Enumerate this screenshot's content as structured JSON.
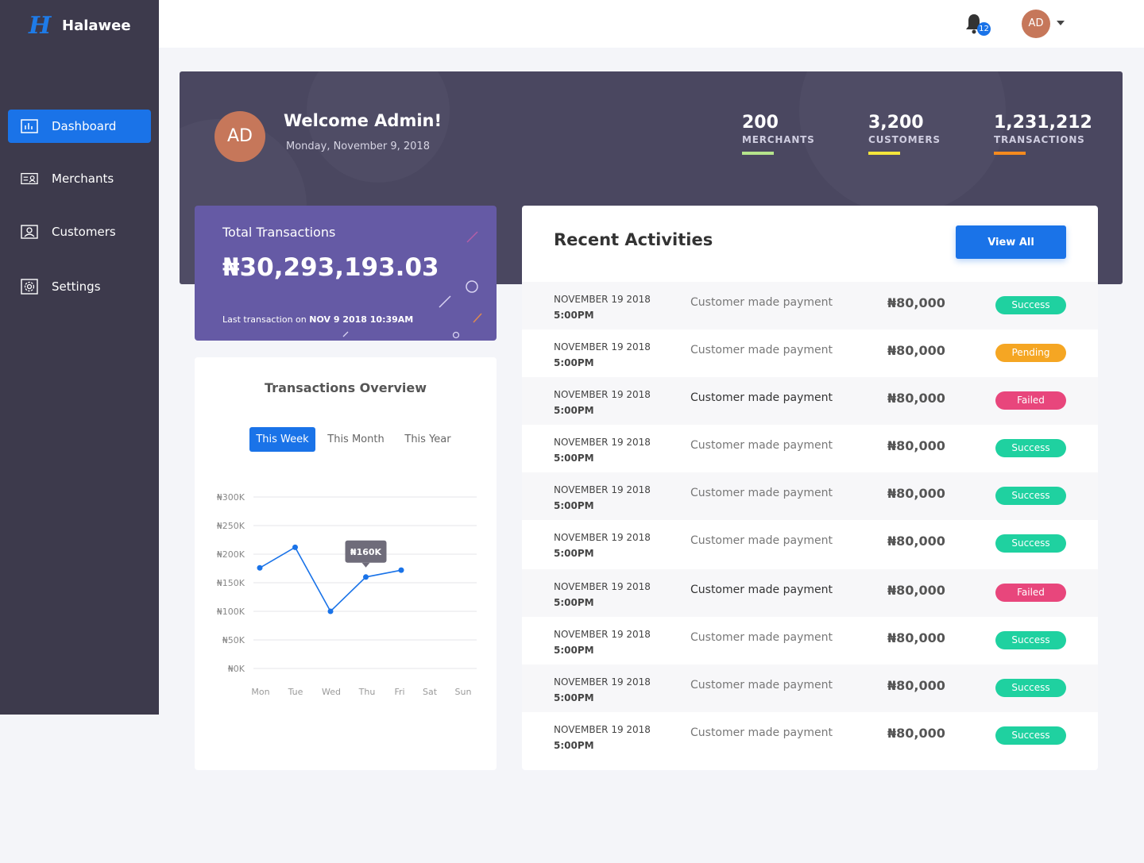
{
  "app": {
    "logo": "H",
    "name": "Halawee"
  },
  "sidebar": {
    "items": [
      {
        "label": "Dashboard",
        "icon": "bar-chart-icon",
        "active": true
      },
      {
        "label": "Merchants",
        "icon": "id-card-icon",
        "active": false
      },
      {
        "label": "Customers",
        "icon": "user-card-icon",
        "active": false
      },
      {
        "label": "Settings",
        "icon": "gear-icon",
        "active": false
      }
    ]
  },
  "header": {
    "notification_count": "12",
    "avatar_initials": "AD"
  },
  "hero": {
    "avatar_initials": "AD",
    "title": "Welcome Admin!",
    "date": "Monday, November 9, 2018",
    "stats": [
      {
        "value": "200",
        "label": "MERCHANTS",
        "color": "#b5e48c"
      },
      {
        "value": "3,200",
        "label": "CUSTOMERS",
        "color": "#f5e63b"
      },
      {
        "value": "1,231,212",
        "label": "TRANSACTIONS",
        "color": "#f58a1f"
      }
    ]
  },
  "total": {
    "label": "Total Transactions",
    "value": "₦30,293,193.03",
    "last_prefix": "Last transaction on",
    "last_value": "NOV 9 2018 10:39AM"
  },
  "overview": {
    "title": "Transactions Overview",
    "tabs": [
      "This Week",
      "This Month",
      "This Year"
    ],
    "active_tab": 0
  },
  "chart_data": {
    "type": "line",
    "categories": [
      "Mon",
      "Tue",
      "Wed",
      "Thu",
      "Fri",
      "Sat",
      "Sun"
    ],
    "y_ticks": [
      "₦300K",
      "₦250K",
      "₦200K",
      "₦150K",
      "₦100K",
      "₦50K",
      "₦0K"
    ],
    "ylim": [
      0,
      300000
    ],
    "series": [
      {
        "values": [
          176000,
          212000,
          100000,
          160000,
          172000
        ],
        "color": "#1a73e8"
      }
    ],
    "tooltip": {
      "index": 3,
      "label": "₦160K"
    },
    "grid": true
  },
  "recent": {
    "title": "Recent Activities",
    "view_all": "View All",
    "status_colors": {
      "Success": "#1fd1a0",
      "Pending": "#f5a623",
      "Failed": "#e8467c"
    },
    "rows": [
      {
        "date": "NOVEMBER 19 2018",
        "time": "5:00PM",
        "desc": "Customer made payment",
        "amount": "₦80,000",
        "status": "Success"
      },
      {
        "date": "NOVEMBER 19 2018",
        "time": "5:00PM",
        "desc": "Customer made payment",
        "amount": "₦80,000",
        "status": "Pending"
      },
      {
        "date": "NOVEMBER 19 2018",
        "time": "5:00PM",
        "desc": "Customer made payment",
        "amount": "₦80,000",
        "status": "Failed"
      },
      {
        "date": "NOVEMBER 19 2018",
        "time": "5:00PM",
        "desc": "Customer made payment",
        "amount": "₦80,000",
        "status": "Success"
      },
      {
        "date": "NOVEMBER 19 2018",
        "time": "5:00PM",
        "desc": "Customer made payment",
        "amount": "₦80,000",
        "status": "Success"
      },
      {
        "date": "NOVEMBER 19 2018",
        "time": "5:00PM",
        "desc": "Customer made payment",
        "amount": "₦80,000",
        "status": "Success"
      },
      {
        "date": "NOVEMBER 19 2018",
        "time": "5:00PM",
        "desc": "Customer made payment",
        "amount": "₦80,000",
        "status": "Failed"
      },
      {
        "date": "NOVEMBER 19 2018",
        "time": "5:00PM",
        "desc": "Customer made payment",
        "amount": "₦80,000",
        "status": "Success"
      },
      {
        "date": "NOVEMBER 19 2018",
        "time": "5:00PM",
        "desc": "Customer made payment",
        "amount": "₦80,000",
        "status": "Success"
      },
      {
        "date": "NOVEMBER 19 2018",
        "time": "5:00PM",
        "desc": "Customer made payment",
        "amount": "₦80,000",
        "status": "Success"
      }
    ]
  }
}
